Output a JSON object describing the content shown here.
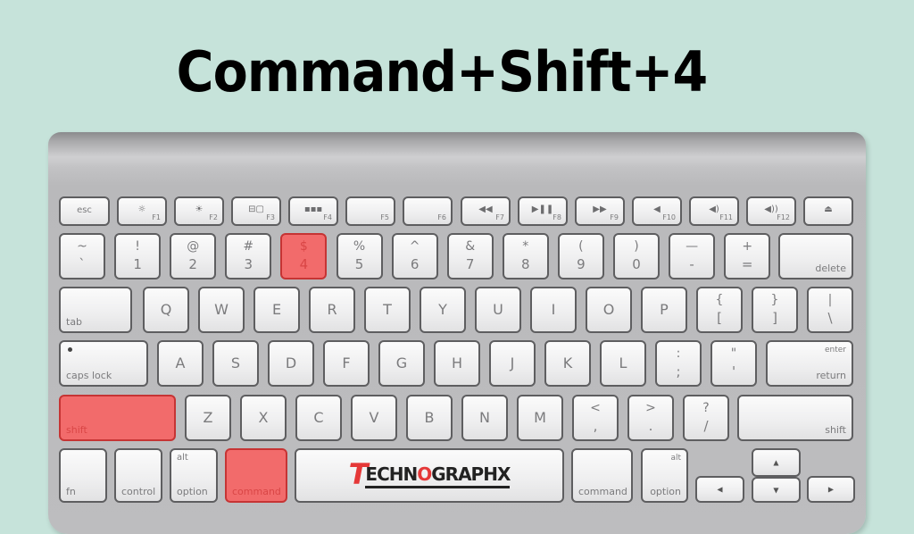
{
  "title": "Command+Shift+4",
  "colors": {
    "background": "#c6e3da",
    "highlight": "#f26b6b",
    "highlight_border": "#c63434",
    "logo_red": "#e53838"
  },
  "highlighted_keys": [
    "4",
    "shift",
    "command"
  ],
  "function_row": {
    "esc": "esc",
    "f1": {
      "label": "F1",
      "icon": "brightness-down-icon",
      "glyph": "☼"
    },
    "f2": {
      "label": "F2",
      "icon": "brightness-up-icon",
      "glyph": "☀"
    },
    "f3": {
      "label": "F3",
      "icon": "mission-control-icon",
      "glyph": "⊟▢"
    },
    "f4": {
      "label": "F4",
      "icon": "dashboard-icon",
      "glyph": "▪▪▪"
    },
    "f5": {
      "label": "F5"
    },
    "f6": {
      "label": "F6"
    },
    "f7": {
      "label": "F7",
      "icon": "rewind-icon",
      "glyph": "◀◀"
    },
    "f8": {
      "label": "F8",
      "icon": "play-pause-icon",
      "glyph": "▶❚❚"
    },
    "f9": {
      "label": "F9",
      "icon": "fast-forward-icon",
      "glyph": "▶▶"
    },
    "f10": {
      "label": "F10",
      "icon": "mute-icon",
      "glyph": "◀"
    },
    "f11": {
      "label": "F11",
      "icon": "volume-down-icon",
      "glyph": "◀)"
    },
    "f12": {
      "label": "F12",
      "icon": "volume-up-icon",
      "glyph": "◀))"
    },
    "eject": {
      "icon": "eject-icon",
      "glyph": "⏏"
    }
  },
  "number_row": {
    "keys": [
      {
        "top": "~",
        "bottom": "`"
      },
      {
        "top": "!",
        "bottom": "1"
      },
      {
        "top": "@",
        "bottom": "2"
      },
      {
        "top": "#",
        "bottom": "3"
      },
      {
        "top": "$",
        "bottom": "4"
      },
      {
        "top": "%",
        "bottom": "5"
      },
      {
        "top": "^",
        "bottom": "6"
      },
      {
        "top": "&",
        "bottom": "7"
      },
      {
        "top": "*",
        "bottom": "8"
      },
      {
        "top": "(",
        "bottom": "9"
      },
      {
        "top": ")",
        "bottom": "0"
      },
      {
        "top": "—",
        "bottom": "-"
      },
      {
        "top": "+",
        "bottom": "="
      }
    ],
    "delete": "delete"
  },
  "qwerty_row": {
    "tab": "tab",
    "letters": [
      "Q",
      "W",
      "E",
      "R",
      "T",
      "Y",
      "U",
      "I",
      "O",
      "P"
    ],
    "brackets": [
      {
        "top": "{",
        "bottom": "["
      },
      {
        "top": "}",
        "bottom": "]"
      },
      {
        "top": "|",
        "bottom": "\\"
      }
    ]
  },
  "home_row": {
    "caps_lock": "caps lock",
    "letters": [
      "A",
      "S",
      "D",
      "F",
      "G",
      "H",
      "J",
      "K",
      "L"
    ],
    "punct": [
      {
        "top": ":",
        "bottom": ";"
      },
      {
        "top": "\"",
        "bottom": "'"
      }
    ],
    "return_top": "enter",
    "return_bottom": "return"
  },
  "shift_row": {
    "shift_left": "shift",
    "letters": [
      "Z",
      "X",
      "C",
      "V",
      "B",
      "N",
      "M"
    ],
    "punct": [
      {
        "top": "<",
        "bottom": ","
      },
      {
        "top": ">",
        "bottom": "."
      },
      {
        "top": "?",
        "bottom": "/"
      }
    ],
    "shift_right": "shift"
  },
  "bottom_row": {
    "fn": "fn",
    "control": "control",
    "option_left": {
      "top": "alt",
      "bottom": "option"
    },
    "command_left": "command",
    "space_logo": {
      "first": "T",
      "part1": "ECHN",
      "o": "O",
      "part2": "GRAPHX"
    },
    "command_right": "command",
    "option_right": {
      "top": "alt",
      "bottom": "option"
    },
    "arrows": {
      "left": "◀",
      "up": "▲",
      "down": "▼",
      "right": "▶"
    }
  }
}
